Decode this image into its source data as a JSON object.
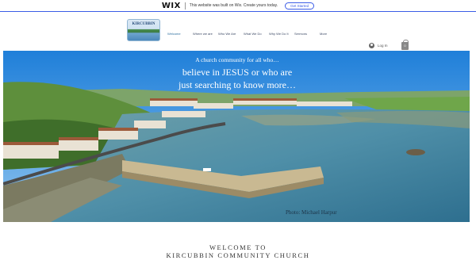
{
  "wix_banner": {
    "logo": "WIX",
    "message": "This website was built on Wix. Create yours today.",
    "button": "Get Started"
  },
  "header": {
    "logo_text": "KIRCUBBIN",
    "nav": [
      "Welcome",
      "Where we are",
      "Who We Are",
      "What We Do",
      "Why We Do It",
      "Sermons",
      "More"
    ],
    "active_nav": "Welcome",
    "login_label": "Log In",
    "cart_count": "0"
  },
  "hero": {
    "line1": "A church community for all who…",
    "line2": "believe in JESUS or who are",
    "line3": "just searching to know more…",
    "photo_credit": "Photo: Michael Harpur"
  },
  "welcome": {
    "line1": "WELCOME TO",
    "line2": "KIRCUBBIN COMMUNITY CHURCH"
  },
  "colors": {
    "accent": "#3b5ce6",
    "nav_text": "#3d4a66",
    "sea": "#4f8fa8",
    "sky": "#2f8ee0"
  }
}
